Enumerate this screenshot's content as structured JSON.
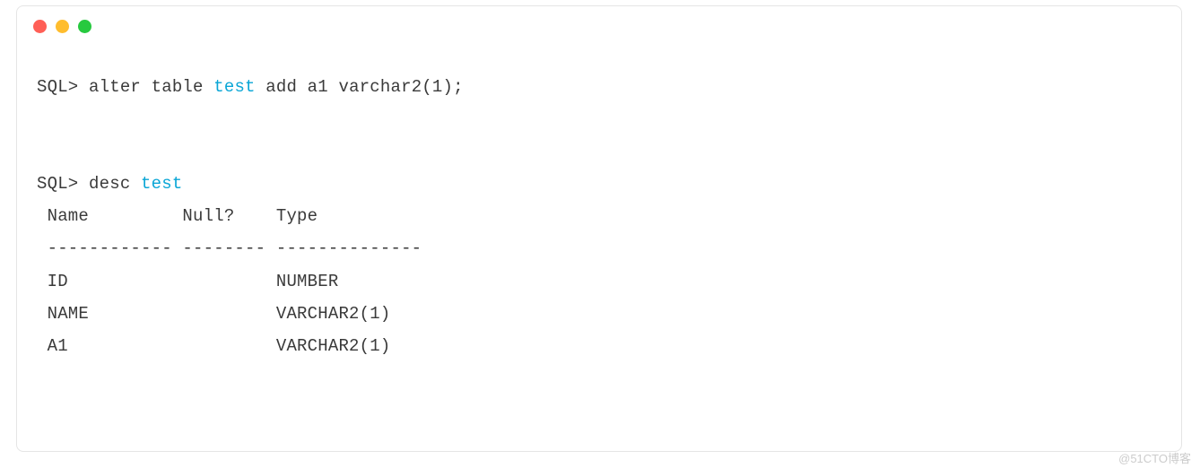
{
  "window": {
    "dots": [
      "red",
      "yellow",
      "green"
    ]
  },
  "sql": {
    "line1": {
      "prompt": "SQL> ",
      "t1": "alter table ",
      "hl": "test",
      "t2": " add a1 varchar2(1);"
    },
    "line2": {
      "prompt": "SQL> ",
      "t1": "desc ",
      "hl": "test"
    }
  },
  "desc_output": {
    "header": " Name         Null?    Type",
    "divider": " ------------ -------- --------------",
    "rows": [
      " ID                    NUMBER",
      " NAME                  VARCHAR2(1)",
      " A1                    VARCHAR2(1)"
    ]
  },
  "watermark": "@51CTO博客"
}
